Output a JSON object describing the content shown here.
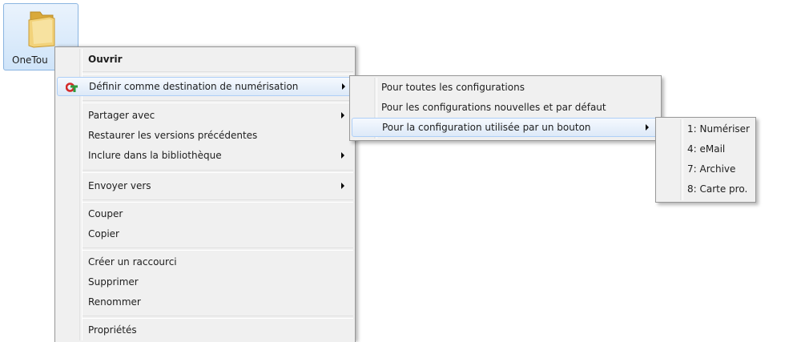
{
  "desktop": {
    "folder_label": "OneTou"
  },
  "context_menu": {
    "items": [
      {
        "label": "Ouvrir"
      },
      {
        "label": "Définir comme destination de numérisation"
      },
      {
        "label": "Partager avec"
      },
      {
        "label": "Restaurer les versions précédentes"
      },
      {
        "label": "Inclure dans la bibliothèque"
      },
      {
        "label": "Envoyer vers"
      },
      {
        "label": "Couper"
      },
      {
        "label": "Copier"
      },
      {
        "label": "Créer un raccourci"
      },
      {
        "label": "Supprimer"
      },
      {
        "label": "Renommer"
      },
      {
        "label": "Propriétés"
      }
    ]
  },
  "submenu": {
    "items": [
      {
        "label": "Pour toutes les configurations"
      },
      {
        "label": "Pour les configurations nouvelles et par défaut"
      },
      {
        "label": "Pour la configuration utilisée par un bouton"
      }
    ]
  },
  "button_menu": {
    "items": [
      {
        "label": "1: Numériser"
      },
      {
        "label": "4: eMail"
      },
      {
        "label": "7: Archive"
      },
      {
        "label": "8: Carte pro."
      }
    ]
  },
  "colors": {
    "highlight": "#dde9f8",
    "highlight_border": "#aecff7",
    "menu_bg": "#f0f0f0",
    "selection": "#cfe4f9"
  }
}
